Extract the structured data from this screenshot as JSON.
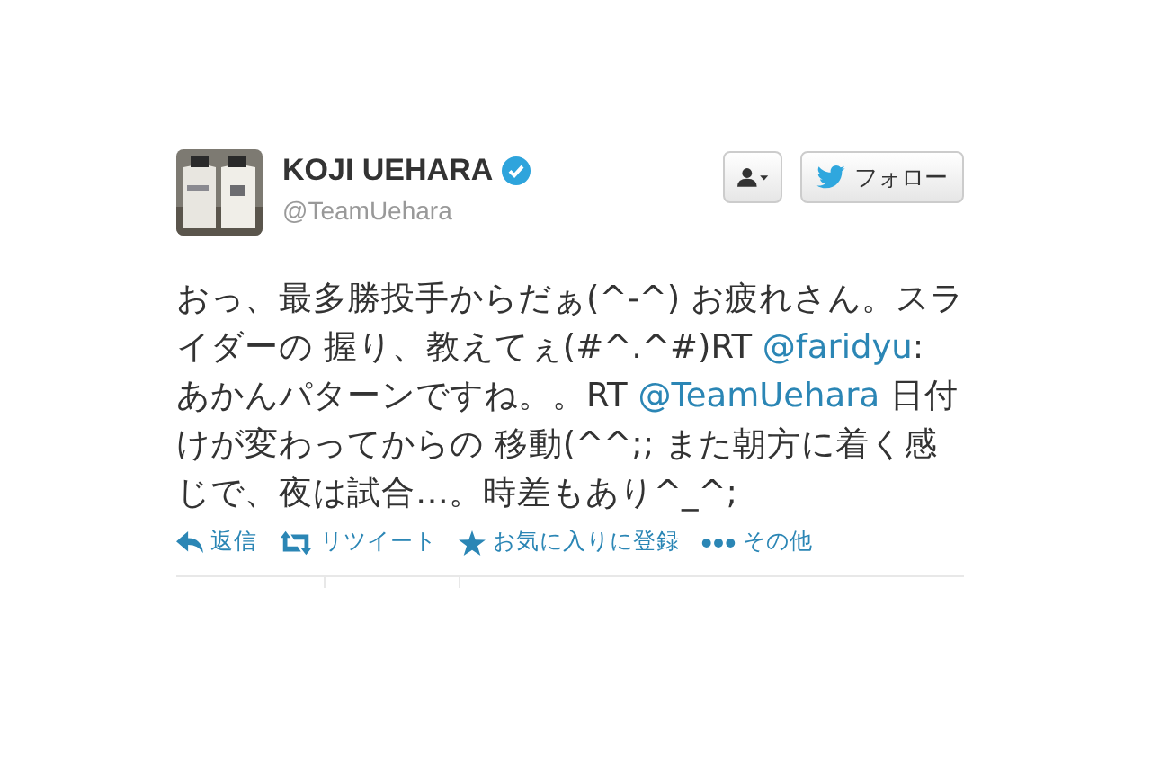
{
  "author": {
    "name": "KOJI UEHARA",
    "verified": true,
    "handle": "@TeamUehara"
  },
  "follow_button": {
    "label": "フォロー"
  },
  "tweet": [
    {
      "kind": "text",
      "text": "おっ、最多勝投手からだぁ(^-^) お疲れさん。スライダーの 握り、教えてぇ(#^.^#)RT "
    },
    {
      "kind": "mention",
      "text": "@faridyu"
    },
    {
      "kind": "text",
      "text": ": あかんパターンですね。。RT "
    },
    {
      "kind": "mention",
      "text": "@TeamUehara"
    },
    {
      "kind": "text",
      "text": " 日付けが変わってからの 移動(^^;;  また朝方に着く感じで、夜は試合…。時差もあり^_^;"
    }
  ],
  "actions": [
    {
      "kind": "reply",
      "label": "返信"
    },
    {
      "kind": "retweet",
      "label": "リツイート"
    },
    {
      "kind": "favorite",
      "label": "お気に入りに登録"
    },
    {
      "kind": "more",
      "label": "その他"
    }
  ]
}
